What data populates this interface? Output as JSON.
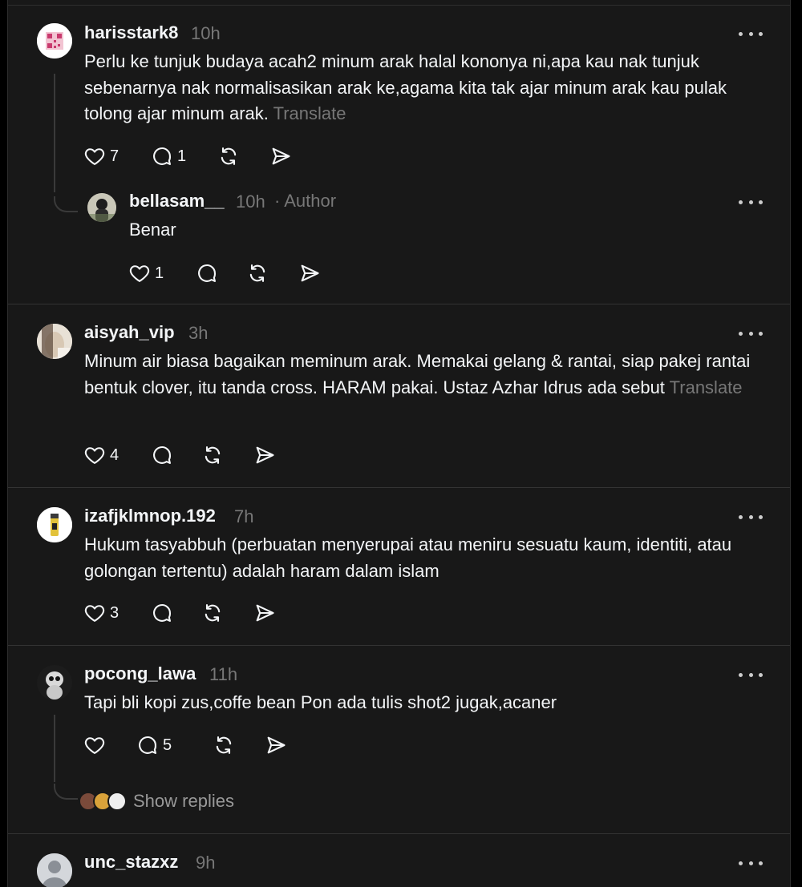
{
  "posts": [
    {
      "username": "harisstark8",
      "time": "10h",
      "text": "Perlu ke tunjuk budaya acah2 minum arak halal kononya ni,apa kau nak tunjuk sebenarnya nak normalisasikan arak ke,agama kita tak ajar minum arak kau pulak tolong ajar minum arak.",
      "translate": "Translate",
      "like_count": "7",
      "reply_count": "1",
      "avatar_icon": "qr-code-avatar"
    },
    {
      "username": "bellasam__",
      "time": "10h",
      "author_label": "· Author",
      "text": "Benar",
      "like_count": "1",
      "reply_count": "",
      "avatar_icon": "photo-avatar"
    },
    {
      "username": "aisyah_vip",
      "time": "3h",
      "text": "Minum air biasa bagaikan meminum arak. Memakai gelang & rantai, siap pakej rantai bentuk clover, itu tanda cross. HARAM pakai. Ustaz Azhar Idrus ada sebut",
      "translate": "Translate",
      "like_count": "4",
      "reply_count": "",
      "avatar_icon": "photo-avatar"
    },
    {
      "username": "izafjklmnop.192",
      "time": "7h",
      "text": "Hukum tasyabbuh (perbuatan menyerupai atau meniru sesuatu kaum, identiti, atau golongan tertentu) adalah haram dalam islam",
      "like_count": "3",
      "reply_count": "",
      "avatar_icon": "lighter-avatar"
    },
    {
      "username": "pocong_lawa",
      "time": "11h",
      "text": "Tapi bli kopi zus,coffe bean Pon ada tulis shot2 jugak,acaner",
      "like_count": "",
      "reply_count": "5",
      "show_replies": "Show replies",
      "avatar_icon": "plush-avatar"
    },
    {
      "username": "unc_stazxz",
      "time": "9h",
      "avatar_icon": "default-avatar"
    }
  ],
  "colors": {
    "background": "#181818",
    "text": "#f3f5f7",
    "muted": "#777777",
    "divider": "#333333"
  }
}
